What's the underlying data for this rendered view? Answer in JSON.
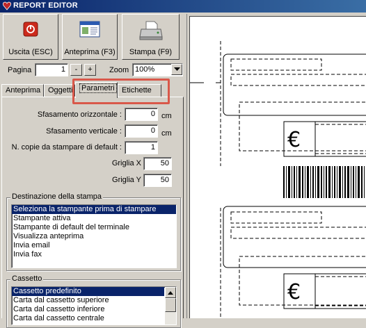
{
  "window": {
    "title": "REPORT EDITOR",
    "icon": "app-heart-icon"
  },
  "toolbar": {
    "exit_label": "Uscita (ESC)",
    "exit_icon": "exit-power-icon",
    "preview_label": "Anteprima (F3)",
    "preview_icon": "preview-window-icon",
    "print_label": "Stampa (F9)",
    "print_icon": "printer-icon"
  },
  "page_nav": {
    "page_label": "Pagina",
    "page_value": "1",
    "minus_label": "-",
    "plus_label": "+",
    "zoom_label": "Zoom",
    "zoom_value": "100%"
  },
  "tabs": [
    {
      "label": "Anteprima"
    },
    {
      "label": "Oggetti"
    },
    {
      "label": "Parametri",
      "active": true
    },
    {
      "label": "Etichette"
    }
  ],
  "params": {
    "offset_h_label": "Sfasamento orizzontale :",
    "offset_h_value": "0",
    "offset_h_unit": "cm",
    "offset_v_label": "Sfasamento verticale :",
    "offset_v_value": "0",
    "offset_v_unit": "cm",
    "copies_label": "N. copie da stampare di default :",
    "copies_value": "1",
    "grid_x_label": "Griglia X",
    "grid_x_value": "50",
    "grid_y_label": "Griglia Y",
    "grid_y_value": "50"
  },
  "destination": {
    "title": "Destinazione della stampa",
    "items": [
      {
        "label": "Seleziona la stampante prima di stampare",
        "selected": true
      },
      {
        "label": "Stampante attiva"
      },
      {
        "label": "Stampante di default del terminale"
      },
      {
        "label": "Visualizza anteprima"
      },
      {
        "label": "Invia email"
      },
      {
        "label": "Invia fax"
      }
    ]
  },
  "tray": {
    "title": "Cassetto",
    "items": [
      {
        "label": "Cassetto predefinito",
        "selected": true
      },
      {
        "label": "Carta dal cassetto superiore"
      },
      {
        "label": "Carta dal cassetto inferiore"
      },
      {
        "label": "Carta dal cassetto centrale"
      }
    ]
  },
  "preview_page": {
    "labels": [
      {
        "currency": "€"
      },
      {
        "currency": "€"
      }
    ]
  },
  "colors": {
    "title_bar": "#0a246a",
    "selection": "#0a246a",
    "highlight_annotation": "#d9584a",
    "face": "#d4d0c8"
  }
}
